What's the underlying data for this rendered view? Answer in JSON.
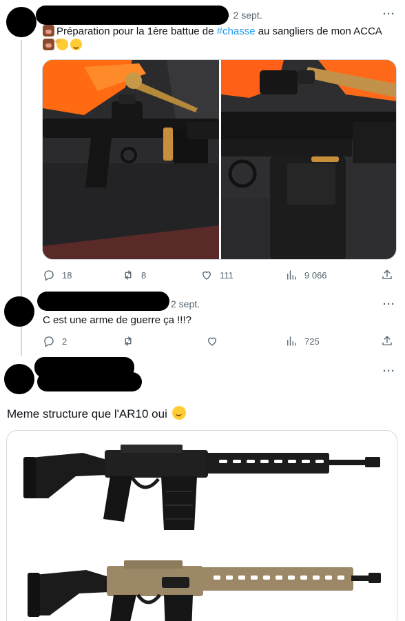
{
  "tweet1": {
    "date": "· 2 sept.",
    "more": "···",
    "text_before": "Préparation pour la 1ère battue de ",
    "hashtag": "#chasse",
    "text_after": " au sangliers de mon ACCA",
    "emojis": [
      "boar-emoji",
      "saluting-face-emoji",
      "relieved-face-emoji"
    ],
    "stats": {
      "replies": "18",
      "retweets": "8",
      "likes": "111",
      "views": "9 066"
    }
  },
  "tweet2": {
    "date": "2 sept.",
    "more": "···",
    "text": "C est une arme de guerre ça !!!?",
    "stats": {
      "replies": "2",
      "retweets": "",
      "likes": "",
      "views": "725"
    }
  },
  "tweet3": {
    "more": "···",
    "text": "Meme structure que l'AR10 oui",
    "emoji": "slightly-smiling-face-emoji"
  },
  "colors": {
    "accent": "#1d9bf0",
    "muted": "#536471",
    "divider": "#cfd9de",
    "rifle_black": "#1b1b1b",
    "rifle_fde": "#9c8866"
  }
}
